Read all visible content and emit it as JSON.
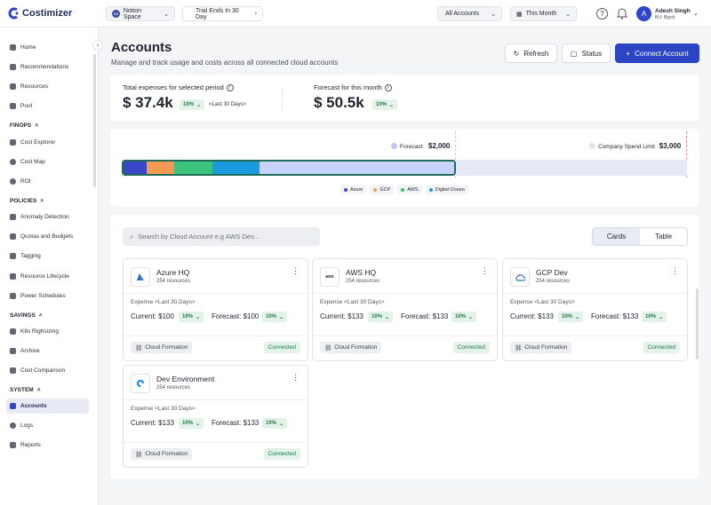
{
  "topbar": {
    "logo_text": "Costimizer",
    "workspace_badge": "NS",
    "workspace": "Notion Space",
    "trial": "Trial Ends In 30 Day",
    "accounts_filter": "All Accounts",
    "period_filter": "This Month",
    "help_icon": "?",
    "user_initial": "A",
    "user_name": "Adesh Singh",
    "user_bu": "BU: Bigoh"
  },
  "sidebar": {
    "items": [
      {
        "label": "Home",
        "icon": "home-icon"
      },
      {
        "label": "Recommendations",
        "icon": "thumb-icon"
      },
      {
        "label": "Resources",
        "icon": "layers-icon"
      },
      {
        "label": "Pool",
        "icon": "pool-icon"
      },
      {
        "label": "Cost Explorer",
        "icon": "explorer-icon"
      },
      {
        "label": "Cost Map",
        "icon": "map-icon"
      },
      {
        "label": "ROI",
        "icon": "roi-icon"
      },
      {
        "label": "Anomaly Detection",
        "icon": "anomaly-icon"
      },
      {
        "label": "Quotas and Budgets",
        "icon": "budget-icon"
      },
      {
        "label": "Tagging",
        "icon": "tag-icon"
      },
      {
        "label": "Resource Lifecycle",
        "icon": "lifecycle-icon"
      },
      {
        "label": "Power Schedules",
        "icon": "schedule-icon"
      },
      {
        "label": "K8s Righsizing",
        "icon": "k8s-icon"
      },
      {
        "label": "Archive",
        "icon": "archive-icon"
      },
      {
        "label": "Cost Comparison",
        "icon": "compare-icon"
      },
      {
        "label": "Accounts",
        "icon": "accounts-icon"
      },
      {
        "label": "Logs",
        "icon": "logs-icon"
      },
      {
        "label": "Reports",
        "icon": "reports-icon"
      }
    ],
    "sections": [
      "FINOPS",
      "POLICIES",
      "SAVINGS",
      "SYSTEM"
    ]
  },
  "header": {
    "title": "Accounts",
    "subtitle": "Manage and track usage and costs across all connected cloud accounts",
    "refresh": "Refresh",
    "status": "Status",
    "connect": "Connect Account"
  },
  "stats": {
    "total_label": "Total expenses for selected period",
    "total_value": "$ 37.4k",
    "total_change": "10%",
    "total_period": "<Last 30 Days>",
    "forecast_label": "Forecast for this month",
    "forecast_value": "$ 50.5k",
    "forecast_change": "10%"
  },
  "spend_bar": {
    "forecast_label": "Forecast:",
    "forecast_value": "$2,000",
    "limit_label": "Company Spend Limit",
    "limit_value": "$3,000",
    "legend": [
      {
        "name": "Azure",
        "color": "#3a47c8"
      },
      {
        "name": "GCP",
        "color": "#f59b54"
      },
      {
        "name": "AWS",
        "color": "#3cc47c"
      },
      {
        "name": "Digital Ocean",
        "color": "#1a9be0"
      }
    ]
  },
  "toolbar": {
    "search_placeholder": "Search by Cloud Account e.g AWS Dev...",
    "view_cards": "Cards",
    "view_table": "Table"
  },
  "accounts": [
    {
      "name": "Azure HQ",
      "resources": "254 resources",
      "expense_label": "Expense <Last 30 Days>",
      "current": "Current: $100",
      "current_change": "10%",
      "forecast": "Forecast: $100",
      "forecast_change": "10%",
      "source": "Cloud Formation",
      "status": "Connected",
      "logo": "azure-logo"
    },
    {
      "name": "AWS HQ",
      "resources": "254 resources",
      "expense_label": "Expense <Last 30 Days>",
      "current": "Current: $133",
      "current_change": "10%",
      "forecast": "Forecast: $133",
      "forecast_change": "10%",
      "source": "Cloud Formation",
      "status": "Connected",
      "logo": "aws-logo"
    },
    {
      "name": "GCP Dev",
      "resources": "254 resources",
      "expense_label": "Expense <Last 30 Days>",
      "current": "Current: $133",
      "current_change": "10%",
      "forecast": "Forecast: $133",
      "forecast_change": "10%",
      "source": "Cloud Formation",
      "status": "Connected",
      "logo": "gcp-logo"
    },
    {
      "name": "Dev Environment",
      "resources": "254 resources",
      "expense_label": "Expense <Last 30 Days>",
      "current": "Current: $133",
      "current_change": "10%",
      "forecast": "Forecast: $133",
      "forecast_change": "10%",
      "source": "Cloud Formation",
      "status": "Connected",
      "logo": "digitalocean-logo"
    }
  ]
}
